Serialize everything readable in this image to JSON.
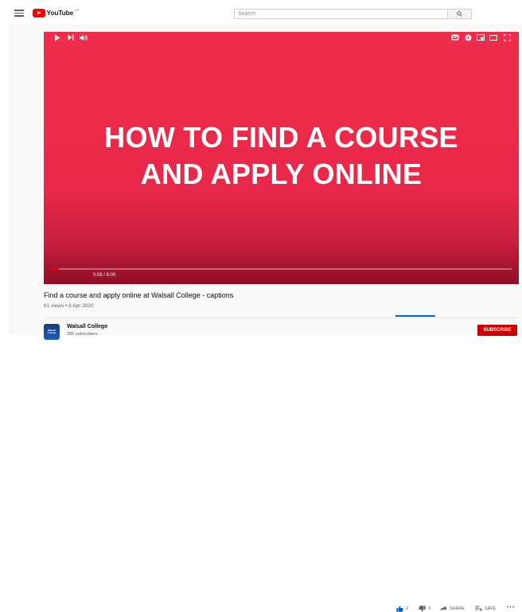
{
  "header": {
    "logo_text": "YouTube",
    "logo_region": "GB",
    "search_placeholder": "Search"
  },
  "video": {
    "overlay_line1": "HOW TO FIND A COURSE",
    "overlay_line2": "AND APPLY ONLINE",
    "time": "0:06 / 6:00",
    "progress": 0.0167,
    "background_color": "#e9284a"
  },
  "info": {
    "title": "Find a course and apply online at Walsall College - captions",
    "meta": "61 views • 8 Apr 2020"
  },
  "actions": {
    "likes": "2",
    "dislikes": "0",
    "share_label": "SHARE",
    "save_label": "SAVE",
    "like_ratio": 1.0
  },
  "channel": {
    "name": "Walsall College",
    "subscribers": "285 subscribers",
    "avatar_text": "Walsall College"
  },
  "subscribe_label": "SUBSCRIBE",
  "colors": {
    "accent": "#065fd4",
    "subscribe": "#cc0000",
    "logo_red": "#ff0000"
  }
}
